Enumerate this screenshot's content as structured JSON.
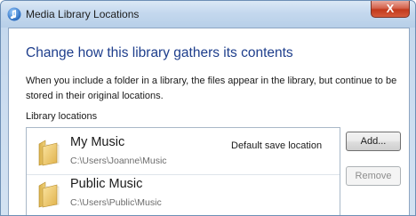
{
  "window": {
    "title": "Media Library Locations",
    "close_glyph": "X"
  },
  "main": {
    "heading": "Change how this library gathers its contents",
    "description": "When you include a folder in a library, the files appear in the library, but continue to be stored in their original locations.",
    "section_label": "Library locations"
  },
  "locations": [
    {
      "name": "My Music",
      "path": "C:\\Users\\Joanne\\Music",
      "badge": "Default save location",
      "icon": "folder-icon"
    },
    {
      "name": "Public Music",
      "path": "C:\\Users\\Public\\Music",
      "badge": "",
      "icon": "folder-icon"
    }
  ],
  "buttons": {
    "add_label": "Add...",
    "remove_label": "Remove"
  },
  "colors": {
    "heading": "#1e3e8c",
    "close_button": "#c2391c"
  }
}
